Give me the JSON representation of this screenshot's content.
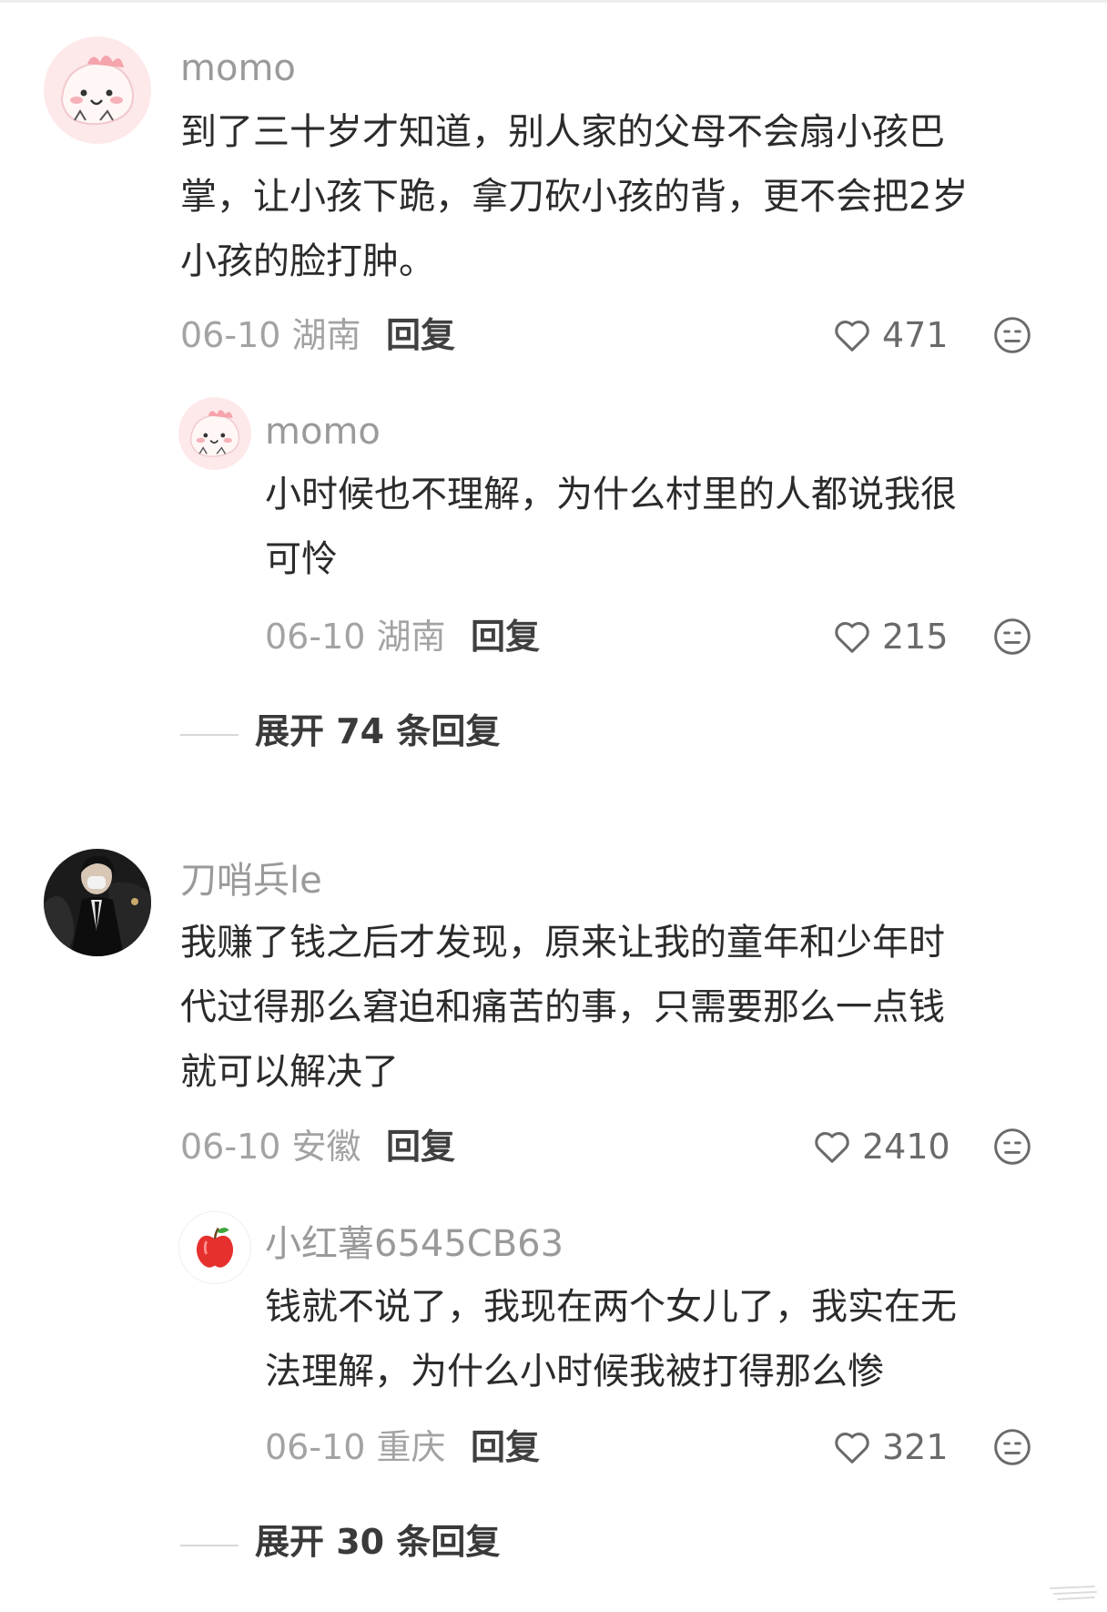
{
  "threads": [
    {
      "comment": {
        "username": "momo",
        "lines": [
          "到了三十岁才知道，别人家的父母不会扇小孩巴",
          "掌，让小孩下跪，拿刀砍小孩的背，更不会把2岁",
          "小孩的脸打肿。"
        ],
        "date": "06-10",
        "location": "湖南",
        "reply_label": "回复",
        "likes": "471"
      },
      "reply": {
        "username": "momo",
        "lines": [
          "小时候也不理解，为什么村里的人都说我很",
          "可怜"
        ],
        "date": "06-10",
        "location": "湖南",
        "reply_label": "回复",
        "likes": "215"
      },
      "expand_label": "展开 74 条回复"
    },
    {
      "comment": {
        "username": "刀哨兵le",
        "lines": [
          "我赚了钱之后才发现，原来让我的童年和少年时",
          "代过得那么窘迫和痛苦的事，只需要那么一点钱",
          "就可以解决了"
        ],
        "date": "06-10",
        "location": "安徽",
        "reply_label": "回复",
        "likes": "2410"
      },
      "reply": {
        "username": "小红薯6545CB63",
        "lines": [
          "钱就不说了，我现在两个女儿了，我实在无",
          "法理解，为什么小时候我被打得那么惨"
        ],
        "date": "06-10",
        "location": "重庆",
        "reply_label": "回复",
        "likes": "321"
      },
      "expand_label": "展开 30 条回复"
    }
  ],
  "colors": {
    "username": "#9a9a9a",
    "body_text": "#2b2b2b",
    "meta": "#a3a3a3",
    "divider": "#d8d8d8"
  },
  "icons": [
    "heart-icon",
    "dislike-face-icon",
    "pink-dinosaur-avatar",
    "person-photo-avatar",
    "apple-avatar"
  ]
}
